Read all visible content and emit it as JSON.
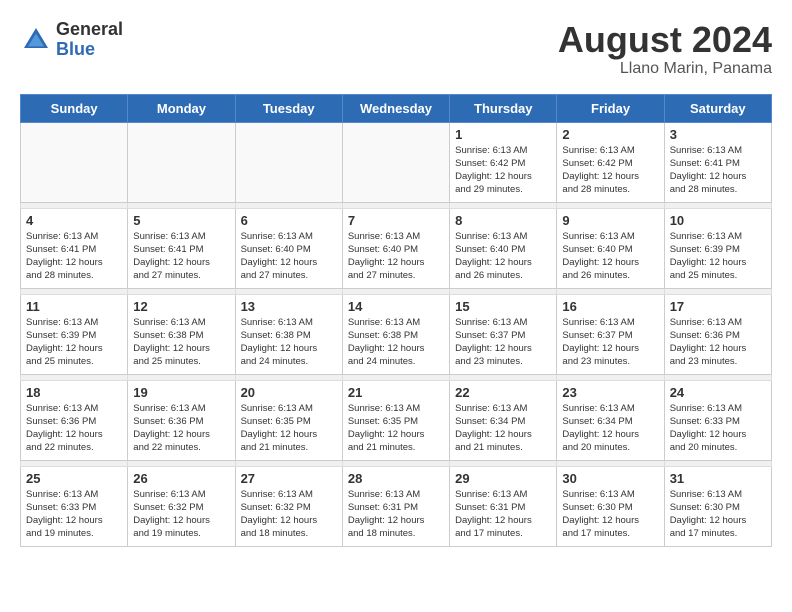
{
  "header": {
    "logo_general": "General",
    "logo_blue": "Blue",
    "month_year": "August 2024",
    "location": "Llano Marin, Panama"
  },
  "weekdays": [
    "Sunday",
    "Monday",
    "Tuesday",
    "Wednesday",
    "Thursday",
    "Friday",
    "Saturday"
  ],
  "weeks": [
    [
      {
        "day": "",
        "info": ""
      },
      {
        "day": "",
        "info": ""
      },
      {
        "day": "",
        "info": ""
      },
      {
        "day": "",
        "info": ""
      },
      {
        "day": "1",
        "info": "Sunrise: 6:13 AM\nSunset: 6:42 PM\nDaylight: 12 hours\nand 29 minutes."
      },
      {
        "day": "2",
        "info": "Sunrise: 6:13 AM\nSunset: 6:42 PM\nDaylight: 12 hours\nand 28 minutes."
      },
      {
        "day": "3",
        "info": "Sunrise: 6:13 AM\nSunset: 6:41 PM\nDaylight: 12 hours\nand 28 minutes."
      }
    ],
    [
      {
        "day": "4",
        "info": "Sunrise: 6:13 AM\nSunset: 6:41 PM\nDaylight: 12 hours\nand 28 minutes."
      },
      {
        "day": "5",
        "info": "Sunrise: 6:13 AM\nSunset: 6:41 PM\nDaylight: 12 hours\nand 27 minutes."
      },
      {
        "day": "6",
        "info": "Sunrise: 6:13 AM\nSunset: 6:40 PM\nDaylight: 12 hours\nand 27 minutes."
      },
      {
        "day": "7",
        "info": "Sunrise: 6:13 AM\nSunset: 6:40 PM\nDaylight: 12 hours\nand 27 minutes."
      },
      {
        "day": "8",
        "info": "Sunrise: 6:13 AM\nSunset: 6:40 PM\nDaylight: 12 hours\nand 26 minutes."
      },
      {
        "day": "9",
        "info": "Sunrise: 6:13 AM\nSunset: 6:40 PM\nDaylight: 12 hours\nand 26 minutes."
      },
      {
        "day": "10",
        "info": "Sunrise: 6:13 AM\nSunset: 6:39 PM\nDaylight: 12 hours\nand 25 minutes."
      }
    ],
    [
      {
        "day": "11",
        "info": "Sunrise: 6:13 AM\nSunset: 6:39 PM\nDaylight: 12 hours\nand 25 minutes."
      },
      {
        "day": "12",
        "info": "Sunrise: 6:13 AM\nSunset: 6:38 PM\nDaylight: 12 hours\nand 25 minutes."
      },
      {
        "day": "13",
        "info": "Sunrise: 6:13 AM\nSunset: 6:38 PM\nDaylight: 12 hours\nand 24 minutes."
      },
      {
        "day": "14",
        "info": "Sunrise: 6:13 AM\nSunset: 6:38 PM\nDaylight: 12 hours\nand 24 minutes."
      },
      {
        "day": "15",
        "info": "Sunrise: 6:13 AM\nSunset: 6:37 PM\nDaylight: 12 hours\nand 23 minutes."
      },
      {
        "day": "16",
        "info": "Sunrise: 6:13 AM\nSunset: 6:37 PM\nDaylight: 12 hours\nand 23 minutes."
      },
      {
        "day": "17",
        "info": "Sunrise: 6:13 AM\nSunset: 6:36 PM\nDaylight: 12 hours\nand 23 minutes."
      }
    ],
    [
      {
        "day": "18",
        "info": "Sunrise: 6:13 AM\nSunset: 6:36 PM\nDaylight: 12 hours\nand 22 minutes."
      },
      {
        "day": "19",
        "info": "Sunrise: 6:13 AM\nSunset: 6:36 PM\nDaylight: 12 hours\nand 22 minutes."
      },
      {
        "day": "20",
        "info": "Sunrise: 6:13 AM\nSunset: 6:35 PM\nDaylight: 12 hours\nand 21 minutes."
      },
      {
        "day": "21",
        "info": "Sunrise: 6:13 AM\nSunset: 6:35 PM\nDaylight: 12 hours\nand 21 minutes."
      },
      {
        "day": "22",
        "info": "Sunrise: 6:13 AM\nSunset: 6:34 PM\nDaylight: 12 hours\nand 21 minutes."
      },
      {
        "day": "23",
        "info": "Sunrise: 6:13 AM\nSunset: 6:34 PM\nDaylight: 12 hours\nand 20 minutes."
      },
      {
        "day": "24",
        "info": "Sunrise: 6:13 AM\nSunset: 6:33 PM\nDaylight: 12 hours\nand 20 minutes."
      }
    ],
    [
      {
        "day": "25",
        "info": "Sunrise: 6:13 AM\nSunset: 6:33 PM\nDaylight: 12 hours\nand 19 minutes."
      },
      {
        "day": "26",
        "info": "Sunrise: 6:13 AM\nSunset: 6:32 PM\nDaylight: 12 hours\nand 19 minutes."
      },
      {
        "day": "27",
        "info": "Sunrise: 6:13 AM\nSunset: 6:32 PM\nDaylight: 12 hours\nand 18 minutes."
      },
      {
        "day": "28",
        "info": "Sunrise: 6:13 AM\nSunset: 6:31 PM\nDaylight: 12 hours\nand 18 minutes."
      },
      {
        "day": "29",
        "info": "Sunrise: 6:13 AM\nSunset: 6:31 PM\nDaylight: 12 hours\nand 17 minutes."
      },
      {
        "day": "30",
        "info": "Sunrise: 6:13 AM\nSunset: 6:30 PM\nDaylight: 12 hours\nand 17 minutes."
      },
      {
        "day": "31",
        "info": "Sunrise: 6:13 AM\nSunset: 6:30 PM\nDaylight: 12 hours\nand 17 minutes."
      }
    ]
  ]
}
